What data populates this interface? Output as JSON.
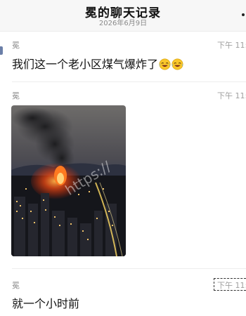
{
  "header": {
    "title": "冕的聊天记录",
    "date": "2026年6月9日"
  },
  "messages": [
    {
      "sender": "冕",
      "time": "下午 11:",
      "text": "我们这一个老小区煤气爆炸了"
    },
    {
      "sender": "冕",
      "time": "下午 11:",
      "image": "city-night-fire-photo",
      "watermark": "https://"
    },
    {
      "sender": "冕",
      "time": "下午 11:",
      "text": "就一个小时前"
    }
  ],
  "icons": {
    "more": "more-dots-icon",
    "emoji": "laughing-tears-emoji-icon"
  },
  "colors": {
    "header_bg": "#f7f7f7",
    "fire": "#ff5a1a",
    "smoke": "#2a2a2e"
  }
}
